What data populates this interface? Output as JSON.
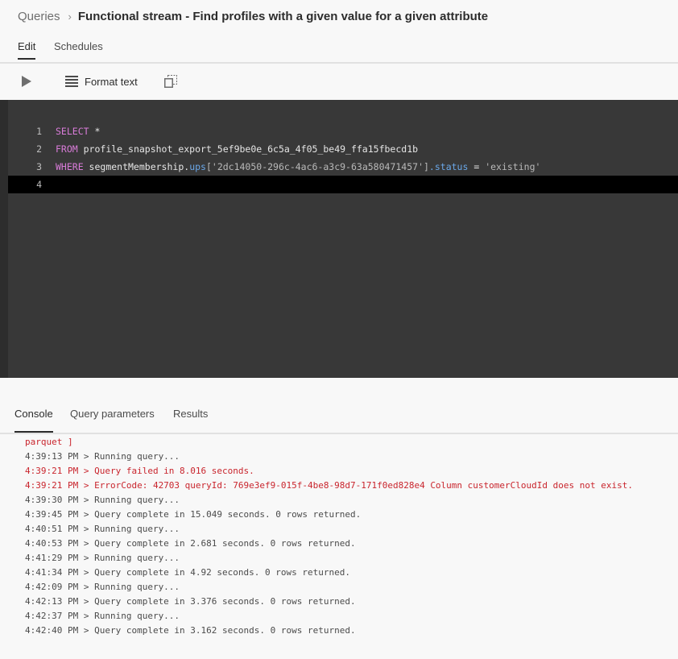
{
  "breadcrumb": {
    "parent": "Queries",
    "separator": "›",
    "title": "Functional stream - Find profiles with a given value for a given attribute"
  },
  "top_tabs": [
    "Edit",
    "Schedules"
  ],
  "toolbar": {
    "run_icon": "play-icon",
    "format_label": "Format text",
    "format_icon": "format-lines-icon",
    "copy_icon": "copy-icon"
  },
  "editor": {
    "line_numbers": [
      "1",
      "2",
      "3",
      "4"
    ],
    "line1": {
      "kw": "SELECT",
      "rest": " *"
    },
    "line2": {
      "kw": "FROM",
      "rest": " profile_snapshot_export_5ef9be0e_6c5a_4f05_be49_ffa15fbecd1b"
    },
    "line3": {
      "kw": "WHERE",
      "part1": " segmentMembership.",
      "prop1": "ups",
      "str1": "['2dc14050-296c-4ac6-a3c9-63a580471457']",
      "dot": ".",
      "prop2": "status",
      "eq": " = ",
      "str2": "'existing'"
    }
  },
  "bottom_tabs": [
    "Console",
    "Query parameters",
    "Results"
  ],
  "console": {
    "lines": [
      {
        "text": "parquet ]",
        "type": "error"
      },
      {
        "text": "4:39:13 PM > Running query...",
        "type": "info"
      },
      {
        "text": "4:39:21 PM > Query failed in 8.016 seconds.",
        "type": "error"
      },
      {
        "text": "4:39:21 PM > ErrorCode: 42703 queryId: 769e3ef9-015f-4be8-98d7-171f0ed828e4 Column customerCloudId does not exist.",
        "type": "error"
      },
      {
        "text": "4:39:30 PM > Running query...",
        "type": "info"
      },
      {
        "text": "4:39:45 PM > Query complete in 15.049 seconds. 0 rows returned.",
        "type": "info"
      },
      {
        "text": "4:40:51 PM > Running query...",
        "type": "info"
      },
      {
        "text": "4:40:53 PM > Query complete in 2.681 seconds. 0 rows returned.",
        "type": "info"
      },
      {
        "text": "4:41:29 PM > Running query...",
        "type": "info"
      },
      {
        "text": "4:41:34 PM > Query complete in 4.92 seconds. 0 rows returned.",
        "type": "info"
      },
      {
        "text": "4:42:09 PM > Running query...",
        "type": "info"
      },
      {
        "text": "4:42:13 PM > Query complete in 3.376 seconds. 0 rows returned.",
        "type": "info"
      },
      {
        "text": "4:42:37 PM > Running query...",
        "type": "info"
      },
      {
        "text": "4:42:40 PM > Query complete in 3.162 seconds. 0 rows returned.",
        "type": "info"
      }
    ]
  },
  "colors": {
    "editor_bg": "#383838",
    "keyword": "#d97cd9",
    "property": "#6aa7e8",
    "error": "#c9252d"
  }
}
